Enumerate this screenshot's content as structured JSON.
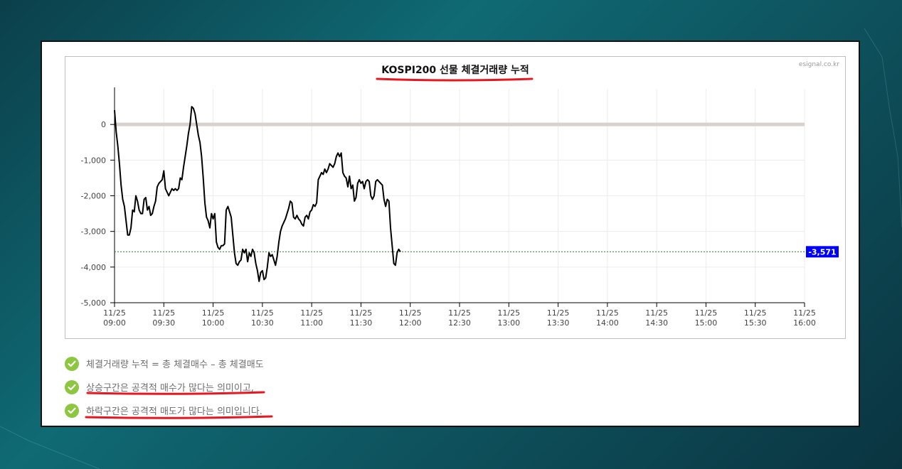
{
  "chart_data": {
    "type": "line",
    "title": "KOSPI200 선물 체결거래량 누적",
    "credit": "esignal.co.kr",
    "xlabel": "",
    "ylabel": "",
    "ylim": [
      -5000,
      1000
    ],
    "xlim": [
      "09:00",
      "16:00"
    ],
    "y_ticks": [
      {
        "value": 0,
        "label": "0"
      },
      {
        "value": -1000,
        "label": "-1,000"
      },
      {
        "value": -2000,
        "label": "-2,000"
      },
      {
        "value": -3000,
        "label": "-3,000"
      },
      {
        "value": -4000,
        "label": "-4,000"
      },
      {
        "value": -5000,
        "label": "-5,000"
      }
    ],
    "x_ticks": [
      {
        "date": "11/25",
        "time": "09:00"
      },
      {
        "date": "11/25",
        "time": "09:30"
      },
      {
        "date": "11/25",
        "time": "10:00"
      },
      {
        "date": "11/25",
        "time": "10:30"
      },
      {
        "date": "11/25",
        "time": "11:00"
      },
      {
        "date": "11/25",
        "time": "11:30"
      },
      {
        "date": "11/25",
        "time": "12:00"
      },
      {
        "date": "11/25",
        "time": "12:30"
      },
      {
        "date": "11/25",
        "time": "13:00"
      },
      {
        "date": "11/25",
        "time": "13:30"
      },
      {
        "date": "11/25",
        "time": "14:00"
      },
      {
        "date": "11/25",
        "time": "14:30"
      },
      {
        "date": "11/25",
        "time": "15:00"
      },
      {
        "date": "11/25",
        "time": "15:30"
      },
      {
        "date": "11/25",
        "time": "16:00"
      }
    ],
    "grid": true,
    "zero_band": 0,
    "series": [
      {
        "color": "#000000",
        "points": [
          [
            "09:00",
            400
          ],
          [
            "09:01",
            -200
          ],
          [
            "09:02",
            -600
          ],
          [
            "09:03",
            -1100
          ],
          [
            "09:04",
            -1700
          ],
          [
            "09:05",
            -2100
          ],
          [
            "09:06",
            -2300
          ],
          [
            "09:07",
            -2700
          ],
          [
            "09:08",
            -3100
          ],
          [
            "09:09",
            -3100
          ],
          [
            "09:10",
            -2900
          ],
          [
            "09:11",
            -2400
          ],
          [
            "09:12",
            -2450
          ],
          [
            "09:13",
            -2000
          ],
          [
            "09:14",
            -2150
          ],
          [
            "09:15",
            -2400
          ],
          [
            "09:16",
            -2500
          ],
          [
            "09:17",
            -2500
          ],
          [
            "09:18",
            -2100
          ],
          [
            "09:19",
            -2050
          ],
          [
            "09:20",
            -2400
          ],
          [
            "09:21",
            -2300
          ],
          [
            "09:22",
            -2550
          ],
          [
            "09:23",
            -2500
          ],
          [
            "09:24",
            -2300
          ],
          [
            "09:25",
            -2150
          ],
          [
            "09:26",
            -1750
          ],
          [
            "09:27",
            -1650
          ],
          [
            "09:28",
            -1600
          ],
          [
            "09:29",
            -1550
          ],
          [
            "09:30",
            -1300
          ],
          [
            "09:31",
            -1800
          ],
          [
            "09:32",
            -1900
          ],
          [
            "09:33",
            -2000
          ],
          [
            "09:34",
            -1900
          ],
          [
            "09:35",
            -1800
          ],
          [
            "09:36",
            -1850
          ],
          [
            "09:37",
            -1800
          ],
          [
            "09:38",
            -1850
          ],
          [
            "09:39",
            -1800
          ],
          [
            "09:40",
            -1500
          ],
          [
            "09:41",
            -1550
          ],
          [
            "09:42",
            -1200
          ],
          [
            "09:43",
            -900
          ],
          [
            "09:44",
            -600
          ],
          [
            "09:45",
            -250
          ],
          [
            "09:46",
            0
          ],
          [
            "09:47",
            500
          ],
          [
            "09:48",
            450
          ],
          [
            "09:49",
            300
          ],
          [
            "09:50",
            0
          ],
          [
            "09:51",
            -300
          ],
          [
            "09:52",
            -500
          ],
          [
            "09:53",
            -900
          ],
          [
            "09:54",
            -1500
          ],
          [
            "09:55",
            -2200
          ],
          [
            "09:56",
            -2600
          ],
          [
            "09:57",
            -2700
          ],
          [
            "09:58",
            -2900
          ],
          [
            "09:59",
            -2500
          ],
          [
            "10:00",
            -2650
          ],
          [
            "10:01",
            -2500
          ],
          [
            "10:02",
            -3300
          ],
          [
            "10:03",
            -3450
          ],
          [
            "10:04",
            -3500
          ],
          [
            "10:05",
            -3400
          ],
          [
            "10:06",
            -3400
          ],
          [
            "10:07",
            -3350
          ],
          [
            "10:08",
            -2400
          ],
          [
            "10:09",
            -2300
          ],
          [
            "10:10",
            -2450
          ],
          [
            "10:11",
            -2600
          ],
          [
            "10:12",
            -3100
          ],
          [
            "10:13",
            -3600
          ],
          [
            "10:14",
            -3900
          ],
          [
            "10:15",
            -3950
          ],
          [
            "10:16",
            -3850
          ],
          [
            "10:17",
            -3800
          ],
          [
            "10:18",
            -3500
          ],
          [
            "10:19",
            -3600
          ],
          [
            "10:20",
            -3500
          ],
          [
            "10:21",
            -3850
          ],
          [
            "10:22",
            -3600
          ],
          [
            "10:23",
            -3700
          ],
          [
            "10:24",
            -3500
          ],
          [
            "10:25",
            -3600
          ],
          [
            "10:26",
            -3900
          ],
          [
            "10:27",
            -4100
          ],
          [
            "10:28",
            -4400
          ],
          [
            "10:29",
            -4150
          ],
          [
            "10:30",
            -4100
          ],
          [
            "10:31",
            -4350
          ],
          [
            "10:32",
            -4300
          ],
          [
            "10:33",
            -4000
          ],
          [
            "10:34",
            -3600
          ],
          [
            "10:35",
            -3700
          ],
          [
            "10:36",
            -3650
          ],
          [
            "10:37",
            -3800
          ],
          [
            "10:38",
            -3950
          ],
          [
            "10:39",
            -3700
          ],
          [
            "10:40",
            -3300
          ],
          [
            "10:41",
            -3000
          ],
          [
            "10:42",
            -2850
          ],
          [
            "10:43",
            -2750
          ],
          [
            "10:44",
            -2650
          ],
          [
            "10:45",
            -2500
          ],
          [
            "10:46",
            -2350
          ],
          [
            "10:47",
            -2150
          ],
          [
            "10:48",
            -2200
          ],
          [
            "10:49",
            -2600
          ],
          [
            "10:50",
            -2650
          ],
          [
            "10:51",
            -2550
          ],
          [
            "10:52",
            -2650
          ],
          [
            "10:53",
            -2700
          ],
          [
            "10:54",
            -2800
          ],
          [
            "10:55",
            -2850
          ],
          [
            "10:56",
            -2600
          ],
          [
            "10:57",
            -2550
          ],
          [
            "10:58",
            -2650
          ],
          [
            "10:59",
            -2450
          ],
          [
            "11:00",
            -2400
          ],
          [
            "11:01",
            -2250
          ],
          [
            "11:02",
            -2300
          ],
          [
            "11:03",
            -2200
          ],
          [
            "11:04",
            -1550
          ],
          [
            "11:05",
            -1450
          ],
          [
            "11:06",
            -1350
          ],
          [
            "11:07",
            -1400
          ],
          [
            "11:08",
            -1250
          ],
          [
            "11:09",
            -1350
          ],
          [
            "11:10",
            -1250
          ],
          [
            "11:11",
            -1100
          ],
          [
            "11:12",
            -1150
          ],
          [
            "11:13",
            -1200
          ],
          [
            "11:14",
            -1100
          ],
          [
            "11:15",
            -900
          ],
          [
            "11:16",
            -800
          ],
          [
            "11:17",
            -900
          ],
          [
            "11:18",
            -800
          ],
          [
            "11:19",
            -1350
          ],
          [
            "11:20",
            -1450
          ],
          [
            "11:21",
            -1500
          ],
          [
            "11:22",
            -1750
          ],
          [
            "11:23",
            -1450
          ],
          [
            "11:24",
            -1800
          ],
          [
            "11:25",
            -1700
          ],
          [
            "11:26",
            -2150
          ],
          [
            "11:27",
            -2050
          ],
          [
            "11:28",
            -1650
          ],
          [
            "11:29",
            -1550
          ],
          [
            "11:30",
            -1650
          ],
          [
            "11:31",
            -1600
          ],
          [
            "11:32",
            -1800
          ],
          [
            "11:33",
            -1600
          ],
          [
            "11:34",
            -1550
          ],
          [
            "11:35",
            -1600
          ],
          [
            "11:36",
            -2000
          ],
          [
            "11:37",
            -2100
          ],
          [
            "11:38",
            -2000
          ],
          [
            "11:39",
            -1600
          ],
          [
            "11:40",
            -1550
          ],
          [
            "11:41",
            -1600
          ],
          [
            "11:42",
            -1650
          ],
          [
            "11:43",
            -1700
          ],
          [
            "11:44",
            -2100
          ],
          [
            "11:45",
            -2300
          ],
          [
            "11:46",
            -2100
          ],
          [
            "11:47",
            -2150
          ],
          [
            "11:48",
            -2900
          ],
          [
            "11:49",
            -3400
          ],
          [
            "11:50",
            -3900
          ],
          [
            "11:51",
            -3950
          ],
          [
            "11:52",
            -3600
          ],
          [
            "11:53",
            -3500
          ],
          [
            "11:54",
            -3571
          ]
        ]
      }
    ],
    "reference_line": {
      "value": -3571,
      "color": "#2e7d32",
      "label": "-3,571",
      "label_color": "#0000ff"
    }
  },
  "annotations": {
    "title_underline_color": "#e8171f",
    "notes_underline_color": "#e8171f"
  },
  "notes": [
    {
      "text": "체결거래량 누적 = 총 체결매수 – 총 체결매도",
      "icon": "check-circle-icon",
      "underlined": false
    },
    {
      "text": "상승구간은 공격적 매수가 많다는 의미이고,",
      "icon": "check-circle-icon",
      "underlined": true
    },
    {
      "text": "하락구간은 공격적 매도가 많다는 의미입니다.",
      "icon": "check-circle-icon",
      "underlined": true
    }
  ]
}
